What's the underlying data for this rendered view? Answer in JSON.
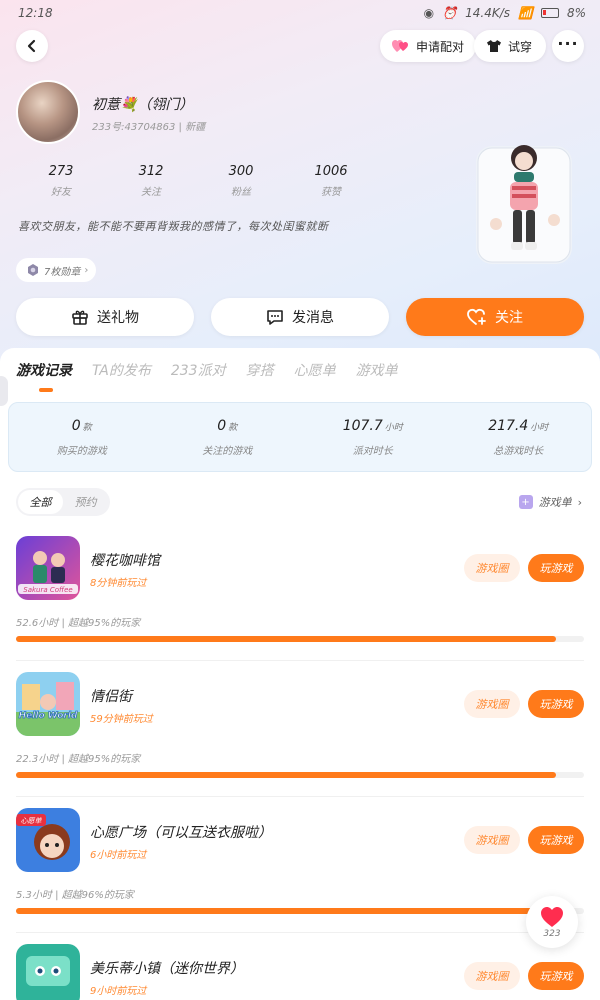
{
  "status_bar": {
    "time": "12:18",
    "network": "14.4K/s",
    "battery": "8%"
  },
  "header": {
    "match_label": "申请配对",
    "try_on_label": "试穿"
  },
  "profile": {
    "nickname": "初薏💐（翎门）",
    "uid_line": "233号:43704863 | 新疆",
    "bio": "喜欢交朋友，能不能不要再背叛我的感情了，每次处闺蜜就断",
    "badge_label": "7枚勋章"
  },
  "stats": [
    {
      "value": "273",
      "label": "好友"
    },
    {
      "value": "312",
      "label": "关注"
    },
    {
      "value": "300",
      "label": "粉丝"
    },
    {
      "value": "1006",
      "label": "获赞"
    }
  ],
  "actions": {
    "gift": "送礼物",
    "message": "发消息",
    "follow": "关注"
  },
  "tabs": [
    "游戏记录",
    "TA的发布",
    "233派对",
    "穿搭",
    "心愿单",
    "游戏单"
  ],
  "summary": [
    {
      "value": "0",
      "unit": "款",
      "label": "购买的游戏"
    },
    {
      "value": "0",
      "unit": "款",
      "label": "关注的游戏"
    },
    {
      "value": "107.7",
      "unit": "小时",
      "label": "派对时长"
    },
    {
      "value": "217.4",
      "unit": "小时",
      "label": "总游戏时长"
    }
  ],
  "filter": {
    "all": "全部",
    "reserve": "预约"
  },
  "game_list_link": "游戏单",
  "buttons": {
    "circle": "游戏圈",
    "play": "玩游戏"
  },
  "games": [
    {
      "name": "樱花咖啡馆",
      "last_played": "8分钟前玩过",
      "hours": "52.6小时 | 超越95%的玩家",
      "progress": 0.95,
      "icon_text": "Sakura Coffee"
    },
    {
      "name": "情侣街",
      "last_played": "59分钟前玩过",
      "hours": "22.3小时 | 超越95%的玩家",
      "progress": 0.95,
      "icon_text": "Hello World"
    },
    {
      "name": "心愿广场（可以互送衣服啦）",
      "last_played": "6小时前玩过",
      "hours": "5.3小时 | 超越96%的玩家",
      "progress": 0.96,
      "icon_text": "心愿单"
    },
    {
      "name": "美乐蒂小镇（迷你世界）",
      "last_played": "9小时前玩过",
      "hours": "",
      "progress": 0,
      "icon_text": ""
    }
  ],
  "like_float": {
    "count": "323"
  },
  "colors": {
    "accent": "#ff7a1a",
    "accent_soft": "#fff0e6",
    "summary_bg": "#eef6fd"
  }
}
